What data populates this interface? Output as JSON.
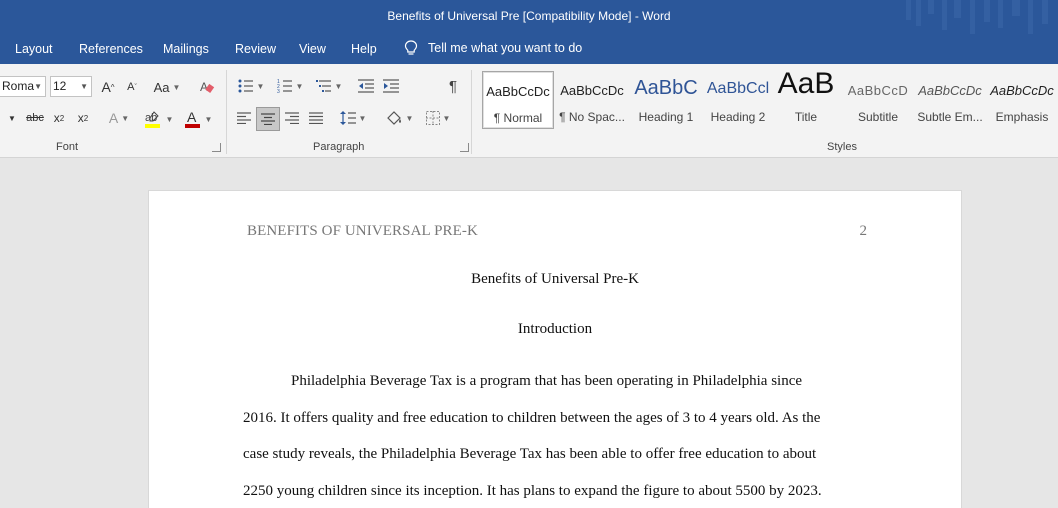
{
  "window": {
    "title": "Benefits of Universal Pre [Compatibility Mode]  -  Word"
  },
  "menu": {
    "tabs": [
      "Layout",
      "References",
      "Mailings",
      "Review",
      "View",
      "Help"
    ],
    "tell_me": "Tell me what you want to do"
  },
  "ribbon": {
    "font": {
      "name": "Roma",
      "size": "12",
      "label": "Font"
    },
    "paragraph": {
      "label": "Paragraph"
    },
    "styles": {
      "label": "Styles",
      "items": [
        {
          "sample": "AaBbCcDc",
          "name": "¶ Normal"
        },
        {
          "sample": "AaBbCcDc",
          "name": "¶ No Spac..."
        },
        {
          "sample": "AaBbC",
          "name": "Heading 1"
        },
        {
          "sample": "AaBbCcl",
          "name": "Heading 2"
        },
        {
          "sample": "AaB",
          "name": "Title"
        },
        {
          "sample": "AaBbCcD",
          "name": "Subtitle"
        },
        {
          "sample": "AaBbCcDc",
          "name": "Subtle Em..."
        },
        {
          "sample": "AaBbCcDc",
          "name": "Emphasis"
        }
      ]
    }
  },
  "document": {
    "running_head": "BENEFITS OF UNIVERSAL PRE-K",
    "page_number": "2",
    "title": "Benefits of Universal Pre-K",
    "heading": "Introduction",
    "lines": [
      "Philadelphia Beverage Tax is a program that has been operating in Philadelphia since",
      "2016. It offers quality and free education to children between the ages of 3 to 4 years old. As the",
      "case study reveals, the Philadelphia Beverage Tax has been able to offer free education to about",
      "2250 young children since its inception. It has plans to expand the figure to about 5500 by 2023."
    ]
  },
  "colors": {
    "accent": "#2b579a",
    "heading1": "#2f5496"
  }
}
